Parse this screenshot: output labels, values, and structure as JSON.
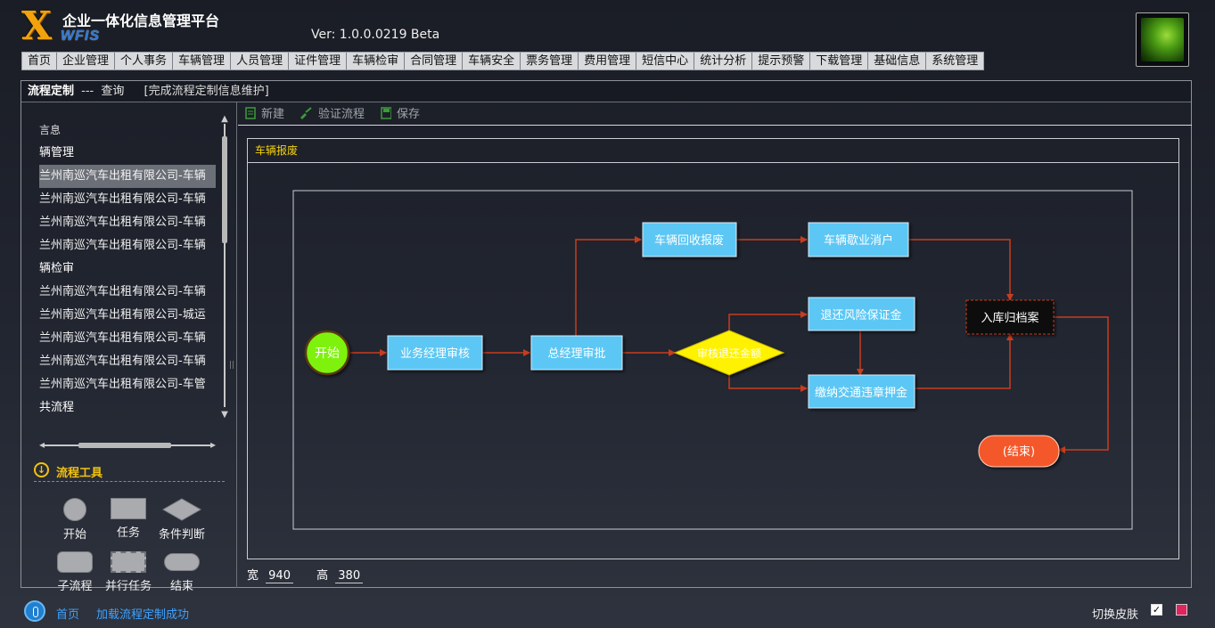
{
  "app": {
    "logo_letter": "X",
    "logo_text": "WFIS",
    "title": "企业一体化信息管理平台",
    "version": "Ver: 1.0.0.0219 Beta"
  },
  "menu": [
    "首页",
    "企业管理",
    "个人事务",
    "车辆管理",
    "人员管理",
    "证件管理",
    "车辆检审",
    "合同管理",
    "车辆安全",
    "票务管理",
    "费用管理",
    "短信中心",
    "统计分析",
    "提示预警",
    "下载管理",
    "基础信息",
    "系统管理"
  ],
  "breadcrumb": {
    "section": "流程定制",
    "separator": "---",
    "page": "查询",
    "desc": "[完成流程定制信息维护]"
  },
  "tree": [
    {
      "label": "言息",
      "kind": "cat"
    },
    {
      "label": "辆管理",
      "kind": "cat"
    },
    {
      "label": "兰州南巡汽车出租有限公司-车辆",
      "kind": "item",
      "selected": true
    },
    {
      "label": "兰州南巡汽车出租有限公司-车辆",
      "kind": "item"
    },
    {
      "label": "兰州南巡汽车出租有限公司-车辆",
      "kind": "item"
    },
    {
      "label": "兰州南巡汽车出租有限公司-车辆",
      "kind": "item"
    },
    {
      "label": "辆检审",
      "kind": "cat"
    },
    {
      "label": "兰州南巡汽车出租有限公司-车辆",
      "kind": "item"
    },
    {
      "label": "兰州南巡汽车出租有限公司-城运",
      "kind": "item"
    },
    {
      "label": "兰州南巡汽车出租有限公司-车辆",
      "kind": "item"
    },
    {
      "label": "兰州南巡汽车出租有限公司-车辆",
      "kind": "item"
    },
    {
      "label": "兰州南巡汽车出租有限公司-车管",
      "kind": "item"
    },
    {
      "label": "共流程",
      "kind": "cat"
    }
  ],
  "tools": {
    "title": "流程工具",
    "items": [
      "开始",
      "任务",
      "条件判断",
      "子流程",
      "并行任务",
      "结束"
    ]
  },
  "toolbar": {
    "new": "新建",
    "validate": "验证流程",
    "save": "保存"
  },
  "canvas": {
    "title": "车辆报废",
    "width_label": "宽",
    "width_value": "940",
    "height_label": "高",
    "height_value": "380"
  },
  "flow": {
    "start": "开始",
    "n1": "业务经理审核",
    "n2": "总经理审批",
    "n3": "车辆回收报废",
    "n4": "车辆歇业消户",
    "n5": "退还风险保证金",
    "n6": "缴纳交通违章押金",
    "n7": "入库归档案",
    "decision": "审核退还金额",
    "end": "(结束)"
  },
  "colors": {
    "task_fill": "#5bc7f4",
    "start_fill": "#7ef20a",
    "end_fill": "#f4582a",
    "decision_fill": "#fff200",
    "arrow": "#c83d1e",
    "archive_fill": "#0d0d0d",
    "tool_title": "#f4c20d",
    "canvas_title": "#f4d10d"
  },
  "status": {
    "home": "首页",
    "message": "加载流程定制成功",
    "skin_label": "切换皮肤"
  }
}
